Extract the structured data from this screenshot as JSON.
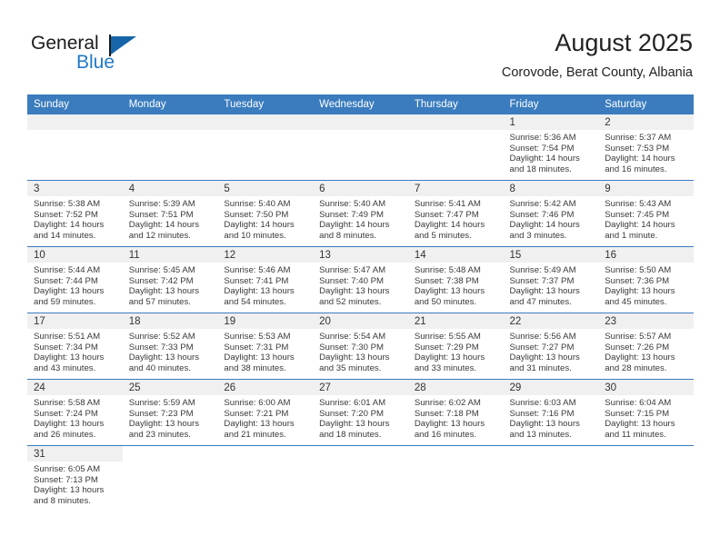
{
  "brand": {
    "name_top": "General",
    "name_bottom": "Blue",
    "flag_color": "#1565a8",
    "blue_text_color": "#2079c7"
  },
  "header": {
    "title": "August 2025",
    "subtitle": "Corovode, Berat County, Albania"
  },
  "theme": {
    "header_blue": "#3A7CBE",
    "daynum_band": "#f0f0f0",
    "text": "#3a3a3a"
  },
  "weekdays": [
    "Sunday",
    "Monday",
    "Tuesday",
    "Wednesday",
    "Thursday",
    "Friday",
    "Saturday"
  ],
  "weeks": [
    [
      {
        "day": "",
        "empty": true,
        "sunrise": "",
        "sunset": "",
        "daylight1": "",
        "daylight2": ""
      },
      {
        "day": "",
        "empty": true,
        "sunrise": "",
        "sunset": "",
        "daylight1": "",
        "daylight2": ""
      },
      {
        "day": "",
        "empty": true,
        "sunrise": "",
        "sunset": "",
        "daylight1": "",
        "daylight2": ""
      },
      {
        "day": "",
        "empty": true,
        "sunrise": "",
        "sunset": "",
        "daylight1": "",
        "daylight2": ""
      },
      {
        "day": "",
        "empty": true,
        "sunrise": "",
        "sunset": "",
        "daylight1": "",
        "daylight2": ""
      },
      {
        "day": "1",
        "empty": false,
        "sunrise": "Sunrise: 5:36 AM",
        "sunset": "Sunset: 7:54 PM",
        "daylight1": "Daylight: 14 hours",
        "daylight2": "and 18 minutes."
      },
      {
        "day": "2",
        "empty": false,
        "sunrise": "Sunrise: 5:37 AM",
        "sunset": "Sunset: 7:53 PM",
        "daylight1": "Daylight: 14 hours",
        "daylight2": "and 16 minutes."
      }
    ],
    [
      {
        "day": "3",
        "empty": false,
        "sunrise": "Sunrise: 5:38 AM",
        "sunset": "Sunset: 7:52 PM",
        "daylight1": "Daylight: 14 hours",
        "daylight2": "and 14 minutes."
      },
      {
        "day": "4",
        "empty": false,
        "sunrise": "Sunrise: 5:39 AM",
        "sunset": "Sunset: 7:51 PM",
        "daylight1": "Daylight: 14 hours",
        "daylight2": "and 12 minutes."
      },
      {
        "day": "5",
        "empty": false,
        "sunrise": "Sunrise: 5:40 AM",
        "sunset": "Sunset: 7:50 PM",
        "daylight1": "Daylight: 14 hours",
        "daylight2": "and 10 minutes."
      },
      {
        "day": "6",
        "empty": false,
        "sunrise": "Sunrise: 5:40 AM",
        "sunset": "Sunset: 7:49 PM",
        "daylight1": "Daylight: 14 hours",
        "daylight2": "and 8 minutes."
      },
      {
        "day": "7",
        "empty": false,
        "sunrise": "Sunrise: 5:41 AM",
        "sunset": "Sunset: 7:47 PM",
        "daylight1": "Daylight: 14 hours",
        "daylight2": "and 5 minutes."
      },
      {
        "day": "8",
        "empty": false,
        "sunrise": "Sunrise: 5:42 AM",
        "sunset": "Sunset: 7:46 PM",
        "daylight1": "Daylight: 14 hours",
        "daylight2": "and 3 minutes."
      },
      {
        "day": "9",
        "empty": false,
        "sunrise": "Sunrise: 5:43 AM",
        "sunset": "Sunset: 7:45 PM",
        "daylight1": "Daylight: 14 hours",
        "daylight2": "and 1 minute."
      }
    ],
    [
      {
        "day": "10",
        "empty": false,
        "sunrise": "Sunrise: 5:44 AM",
        "sunset": "Sunset: 7:44 PM",
        "daylight1": "Daylight: 13 hours",
        "daylight2": "and 59 minutes."
      },
      {
        "day": "11",
        "empty": false,
        "sunrise": "Sunrise: 5:45 AM",
        "sunset": "Sunset: 7:42 PM",
        "daylight1": "Daylight: 13 hours",
        "daylight2": "and 57 minutes."
      },
      {
        "day": "12",
        "empty": false,
        "sunrise": "Sunrise: 5:46 AM",
        "sunset": "Sunset: 7:41 PM",
        "daylight1": "Daylight: 13 hours",
        "daylight2": "and 54 minutes."
      },
      {
        "day": "13",
        "empty": false,
        "sunrise": "Sunrise: 5:47 AM",
        "sunset": "Sunset: 7:40 PM",
        "daylight1": "Daylight: 13 hours",
        "daylight2": "and 52 minutes."
      },
      {
        "day": "14",
        "empty": false,
        "sunrise": "Sunrise: 5:48 AM",
        "sunset": "Sunset: 7:38 PM",
        "daylight1": "Daylight: 13 hours",
        "daylight2": "and 50 minutes."
      },
      {
        "day": "15",
        "empty": false,
        "sunrise": "Sunrise: 5:49 AM",
        "sunset": "Sunset: 7:37 PM",
        "daylight1": "Daylight: 13 hours",
        "daylight2": "and 47 minutes."
      },
      {
        "day": "16",
        "empty": false,
        "sunrise": "Sunrise: 5:50 AM",
        "sunset": "Sunset: 7:36 PM",
        "daylight1": "Daylight: 13 hours",
        "daylight2": "and 45 minutes."
      }
    ],
    [
      {
        "day": "17",
        "empty": false,
        "sunrise": "Sunrise: 5:51 AM",
        "sunset": "Sunset: 7:34 PM",
        "daylight1": "Daylight: 13 hours",
        "daylight2": "and 43 minutes."
      },
      {
        "day": "18",
        "empty": false,
        "sunrise": "Sunrise: 5:52 AM",
        "sunset": "Sunset: 7:33 PM",
        "daylight1": "Daylight: 13 hours",
        "daylight2": "and 40 minutes."
      },
      {
        "day": "19",
        "empty": false,
        "sunrise": "Sunrise: 5:53 AM",
        "sunset": "Sunset: 7:31 PM",
        "daylight1": "Daylight: 13 hours",
        "daylight2": "and 38 minutes."
      },
      {
        "day": "20",
        "empty": false,
        "sunrise": "Sunrise: 5:54 AM",
        "sunset": "Sunset: 7:30 PM",
        "daylight1": "Daylight: 13 hours",
        "daylight2": "and 35 minutes."
      },
      {
        "day": "21",
        "empty": false,
        "sunrise": "Sunrise: 5:55 AM",
        "sunset": "Sunset: 7:29 PM",
        "daylight1": "Daylight: 13 hours",
        "daylight2": "and 33 minutes."
      },
      {
        "day": "22",
        "empty": false,
        "sunrise": "Sunrise: 5:56 AM",
        "sunset": "Sunset: 7:27 PM",
        "daylight1": "Daylight: 13 hours",
        "daylight2": "and 31 minutes."
      },
      {
        "day": "23",
        "empty": false,
        "sunrise": "Sunrise: 5:57 AM",
        "sunset": "Sunset: 7:26 PM",
        "daylight1": "Daylight: 13 hours",
        "daylight2": "and 28 minutes."
      }
    ],
    [
      {
        "day": "24",
        "empty": false,
        "sunrise": "Sunrise: 5:58 AM",
        "sunset": "Sunset: 7:24 PM",
        "daylight1": "Daylight: 13 hours",
        "daylight2": "and 26 minutes."
      },
      {
        "day": "25",
        "empty": false,
        "sunrise": "Sunrise: 5:59 AM",
        "sunset": "Sunset: 7:23 PM",
        "daylight1": "Daylight: 13 hours",
        "daylight2": "and 23 minutes."
      },
      {
        "day": "26",
        "empty": false,
        "sunrise": "Sunrise: 6:00 AM",
        "sunset": "Sunset: 7:21 PM",
        "daylight1": "Daylight: 13 hours",
        "daylight2": "and 21 minutes."
      },
      {
        "day": "27",
        "empty": false,
        "sunrise": "Sunrise: 6:01 AM",
        "sunset": "Sunset: 7:20 PM",
        "daylight1": "Daylight: 13 hours",
        "daylight2": "and 18 minutes."
      },
      {
        "day": "28",
        "empty": false,
        "sunrise": "Sunrise: 6:02 AM",
        "sunset": "Sunset: 7:18 PM",
        "daylight1": "Daylight: 13 hours",
        "daylight2": "and 16 minutes."
      },
      {
        "day": "29",
        "empty": false,
        "sunrise": "Sunrise: 6:03 AM",
        "sunset": "Sunset: 7:16 PM",
        "daylight1": "Daylight: 13 hours",
        "daylight2": "and 13 minutes."
      },
      {
        "day": "30",
        "empty": false,
        "sunrise": "Sunrise: 6:04 AM",
        "sunset": "Sunset: 7:15 PM",
        "daylight1": "Daylight: 13 hours",
        "daylight2": "and 11 minutes."
      }
    ],
    [
      {
        "day": "31",
        "empty": false,
        "sunrise": "Sunrise: 6:05 AM",
        "sunset": "Sunset: 7:13 PM",
        "daylight1": "Daylight: 13 hours",
        "daylight2": "and 8 minutes."
      },
      {
        "day": "",
        "empty": true,
        "sunrise": "",
        "sunset": "",
        "daylight1": "",
        "daylight2": ""
      },
      {
        "day": "",
        "empty": true,
        "sunrise": "",
        "sunset": "",
        "daylight1": "",
        "daylight2": ""
      },
      {
        "day": "",
        "empty": true,
        "sunrise": "",
        "sunset": "",
        "daylight1": "",
        "daylight2": ""
      },
      {
        "day": "",
        "empty": true,
        "sunrise": "",
        "sunset": "",
        "daylight1": "",
        "daylight2": ""
      },
      {
        "day": "",
        "empty": true,
        "sunrise": "",
        "sunset": "",
        "daylight1": "",
        "daylight2": ""
      },
      {
        "day": "",
        "empty": true,
        "sunrise": "",
        "sunset": "",
        "daylight1": "",
        "daylight2": ""
      }
    ]
  ]
}
